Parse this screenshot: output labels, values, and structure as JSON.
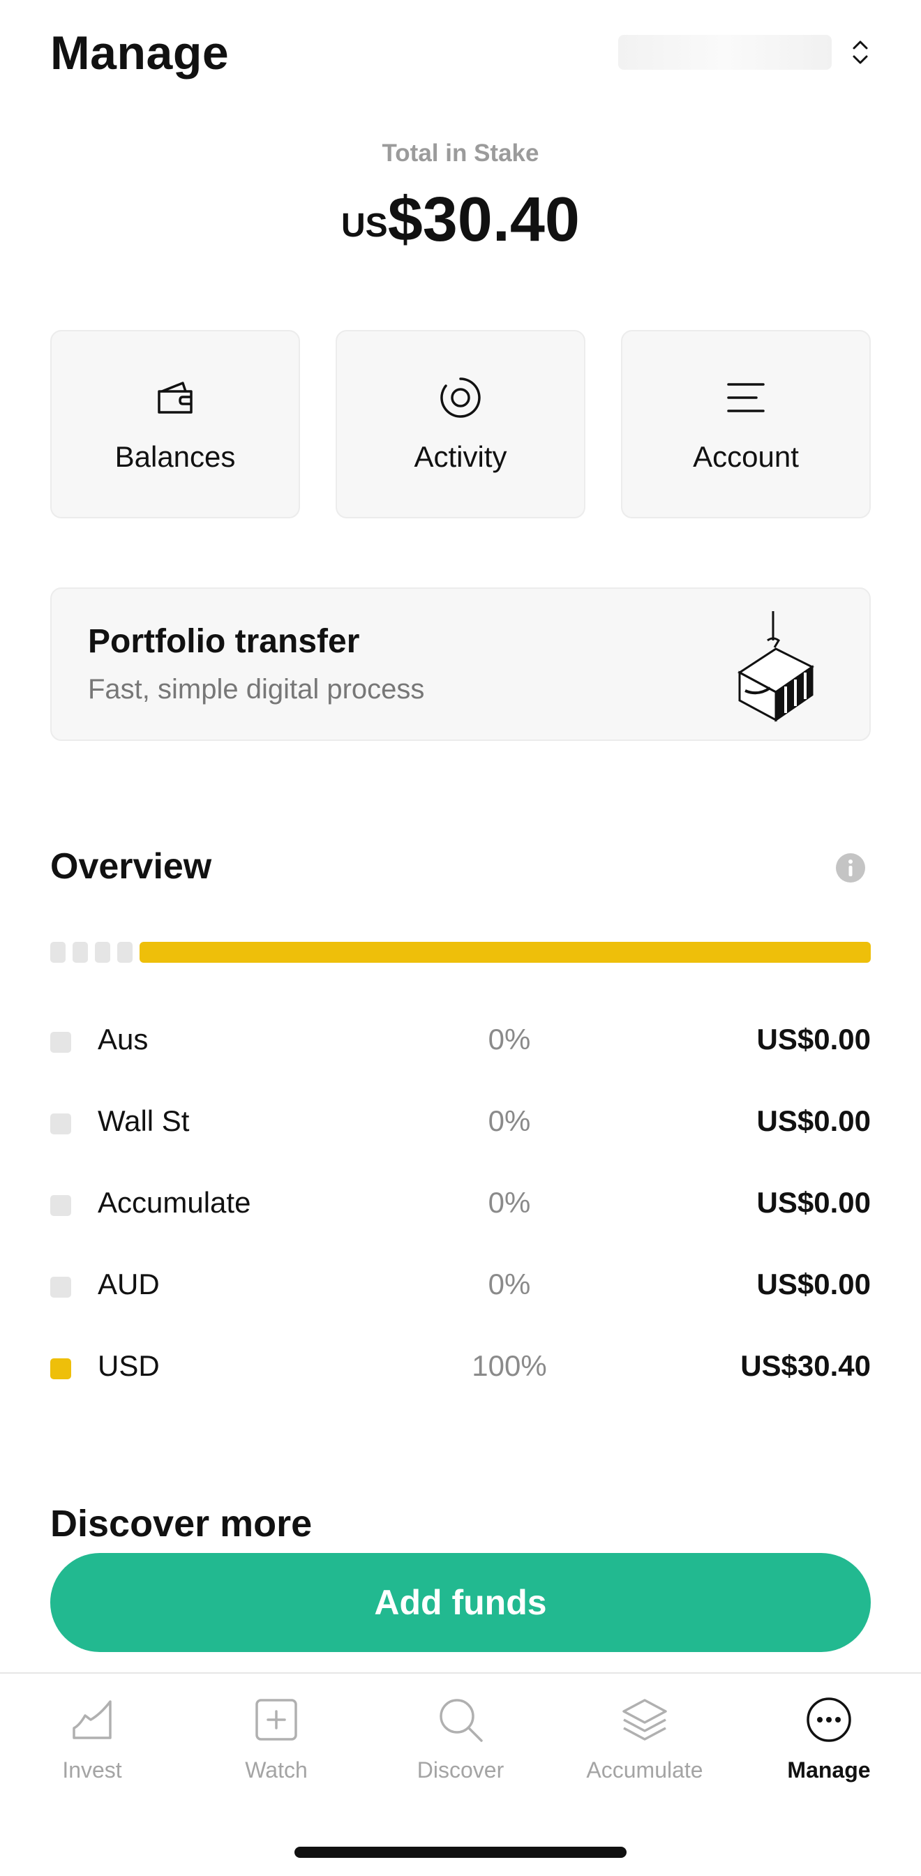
{
  "header": {
    "title": "Manage"
  },
  "total": {
    "label": "Total in Stake",
    "currency": "US",
    "amount": "$30.40"
  },
  "tiles": [
    {
      "label": "Balances",
      "icon": "wallet-icon"
    },
    {
      "label": "Activity",
      "icon": "activity-icon"
    },
    {
      "label": "Account",
      "icon": "menu-icon"
    }
  ],
  "transfer": {
    "title": "Portfolio transfer",
    "subtitle": "Fast, simple digital process"
  },
  "overview": {
    "title": "Overview",
    "bar_color": "#eebf0a",
    "rows": [
      {
        "name": "Aus",
        "percent": "0%",
        "amount": "US$0.00",
        "color": "#e5e5e5"
      },
      {
        "name": "Wall St",
        "percent": "0%",
        "amount": "US$0.00",
        "color": "#e5e5e5"
      },
      {
        "name": "Accumulate",
        "percent": "0%",
        "amount": "US$0.00",
        "color": "#e5e5e5"
      },
      {
        "name": "AUD",
        "percent": "0%",
        "amount": "US$0.00",
        "color": "#e5e5e5"
      },
      {
        "name": "USD",
        "percent": "100%",
        "amount": "US$30.40",
        "color": "#eebf0a"
      }
    ]
  },
  "discover": {
    "title": "Discover more"
  },
  "cta": {
    "label": "Add funds",
    "color": "#22b990"
  },
  "tabbar": [
    {
      "label": "Invest",
      "icon": "chart-icon",
      "active": false
    },
    {
      "label": "Watch",
      "icon": "plus-square-icon",
      "active": false
    },
    {
      "label": "Discover",
      "icon": "search-icon",
      "active": false
    },
    {
      "label": "Accumulate",
      "icon": "layers-icon",
      "active": false
    },
    {
      "label": "Manage",
      "icon": "more-icon",
      "active": true
    }
  ]
}
